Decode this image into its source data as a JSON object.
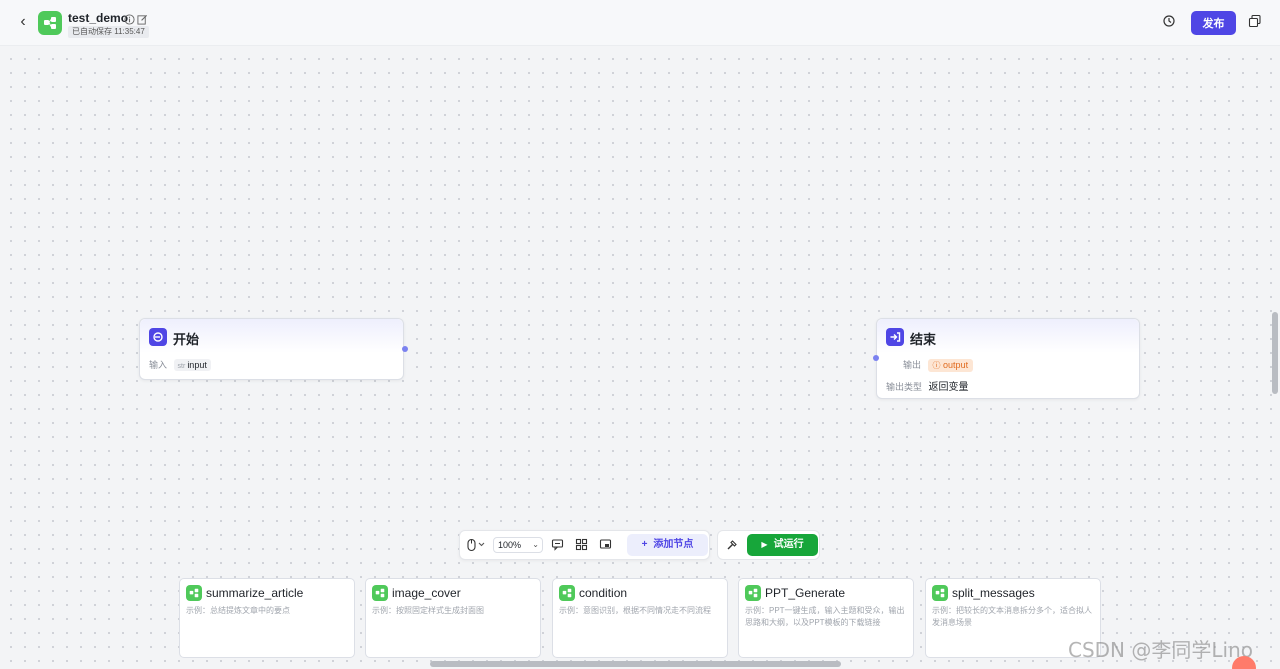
{
  "header": {
    "back_label": "‹",
    "title": "test_demo",
    "save_status": "已自动保存 11:35:47",
    "publish_label": "发布"
  },
  "nodes": {
    "start": {
      "title": "开始",
      "input_label": "输入",
      "var_type": "str",
      "var_name": "input"
    },
    "end": {
      "title": "结束",
      "output_label": "输出",
      "output_var": "output",
      "output_type_label": "输出类型",
      "output_type_value": "返回变量"
    }
  },
  "toolbar": {
    "zoom": "100%",
    "add_node_label": "添加节点",
    "run_label": "试运行"
  },
  "templates": [
    {
      "title": "summarize_article",
      "desc": "示例：总结提炼文章中的要点"
    },
    {
      "title": "image_cover",
      "desc": "示例：按照固定样式生成封面图"
    },
    {
      "title": "condition",
      "desc": "示例：意图识别，根据不同情况走不同流程"
    },
    {
      "title": "PPT_Generate",
      "desc": "示例：PPT一键生成，输入主题和受众，输出思路和大纲，以及PPT模板的下载链接"
    },
    {
      "title": "split_messages",
      "desc": "示例：把较长的文本消息拆分多个，适合拟人发消息场景"
    }
  ],
  "watermark": "CSDN @李同学Lino",
  "colors": {
    "primary": "#4f46e5",
    "run_green": "#17a63a",
    "logo_green": "#4fc95a",
    "output_orange": "#e06b1f"
  }
}
